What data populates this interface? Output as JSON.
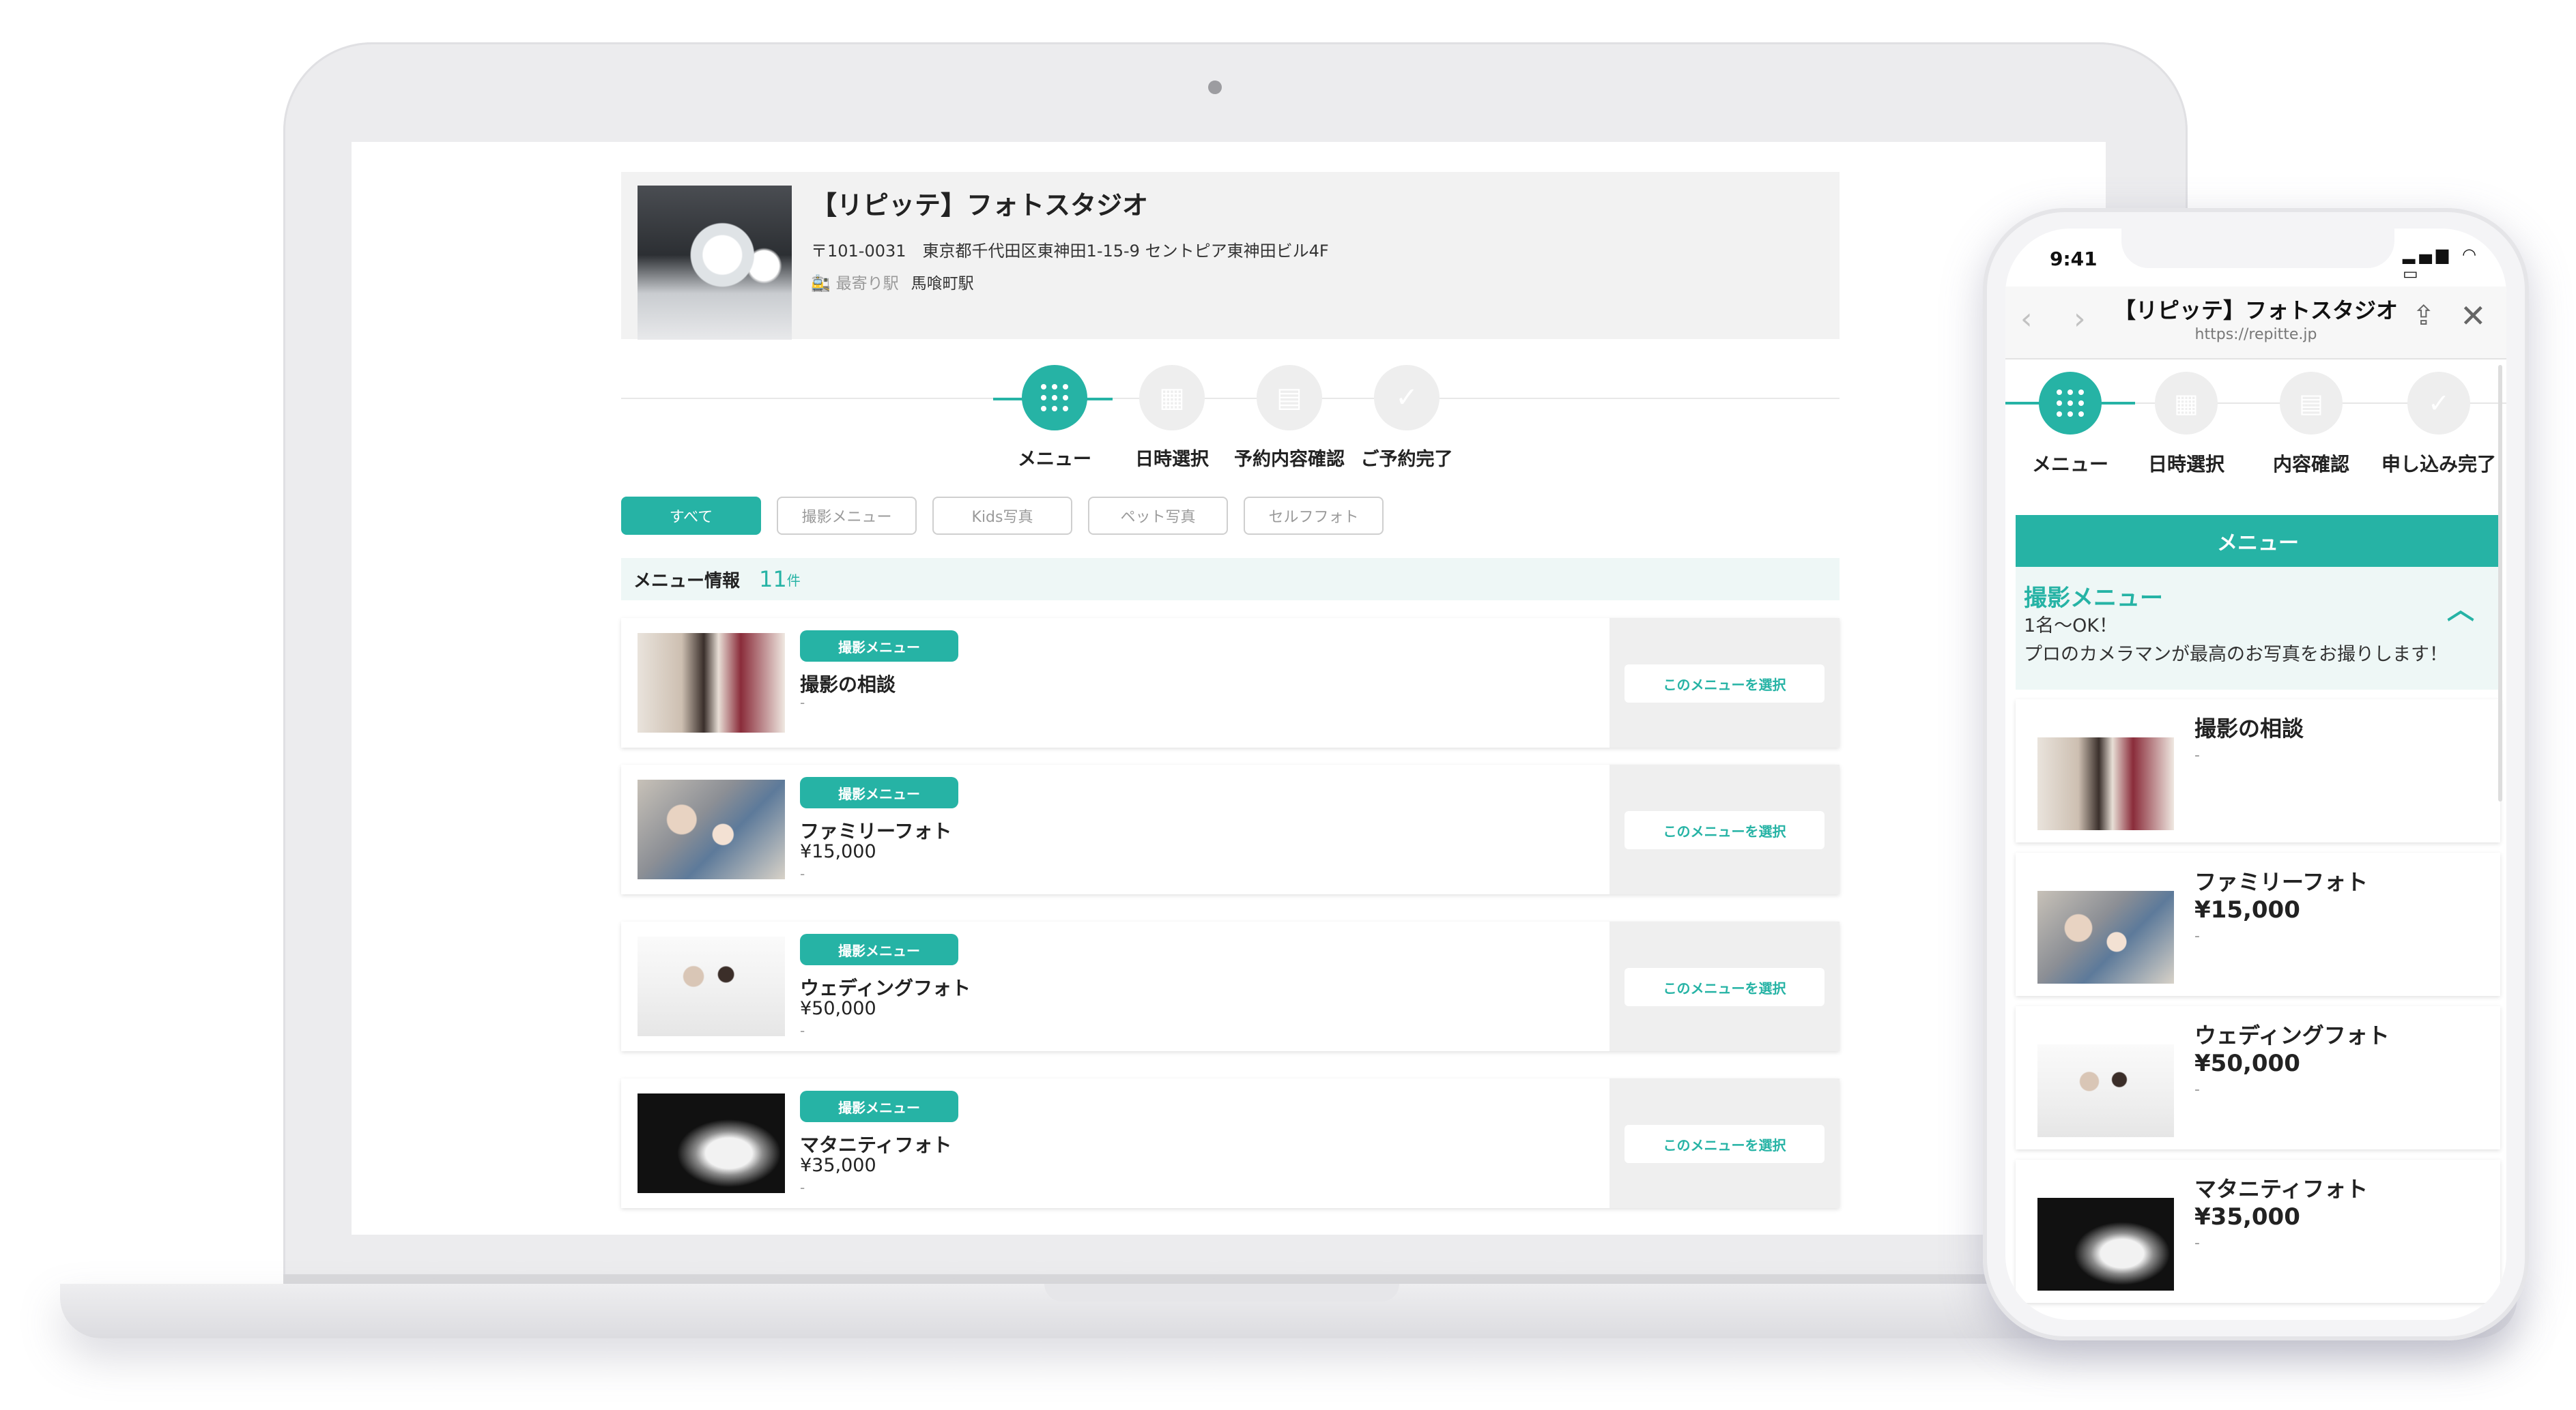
{
  "studio": {
    "name": "【リピッテ】フォトスタジオ",
    "address": "〒101-0031　東京都千代田区東神田1-15-9 セントピア東神田ビル4F",
    "station_label": "最寄り駅",
    "station": "馬喰町駅"
  },
  "steps": [
    {
      "label": "メニュー",
      "active": true
    },
    {
      "label": "日時選択",
      "active": false
    },
    {
      "label": "予約内容確認",
      "active": false
    },
    {
      "label": "ご予約完了",
      "active": false
    }
  ],
  "tabs": [
    "すべて",
    "撮影メニュー",
    "Kids写真",
    "ペット写真",
    "セルフフォト"
  ],
  "menu_info": {
    "label": "メニュー情報",
    "count": "11",
    "unit": "件"
  },
  "menus": [
    {
      "badge": "撮影メニュー",
      "name": "撮影の相談",
      "price": "",
      "note": "-",
      "button": "このメニューを選択"
    },
    {
      "badge": "撮影メニュー",
      "name": "ファミリーフォト",
      "price": "¥15,000",
      "note": "-",
      "button": "このメニューを選択"
    },
    {
      "badge": "撮影メニュー",
      "name": "ウェディングフォト",
      "price": "¥50,000",
      "note": "-",
      "button": "このメニューを選択"
    },
    {
      "badge": "撮影メニュー",
      "name": "マタニティフォト",
      "price": "¥35,000",
      "note": "-",
      "button": "このメニューを選択"
    }
  ],
  "phone": {
    "time": "9:41",
    "status": "▂▄▆ ◠ ▭",
    "nav": {
      "back": "‹",
      "forward": "›",
      "title": "【リピッテ】フォトスタジオ",
      "url": "https://repitte.jp",
      "share": "⇪",
      "close": "✕"
    },
    "steps": [
      {
        "label": "メニュー",
        "active": true
      },
      {
        "label": "日時選択",
        "active": false
      },
      {
        "label": "内容確認",
        "active": false
      },
      {
        "label": "申し込み完了",
        "active": false
      }
    ],
    "menu_header": "メニュー",
    "category": {
      "title": "撮影メニュー",
      "text": "1名〜OK！\nプロのカメラマンが最高のお写真をお撮りします！",
      "chevron": "︿"
    },
    "menus": [
      {
        "name": "撮影の相談",
        "price": "",
        "note": "-"
      },
      {
        "name": "ファミリーフォト",
        "price": "¥15,000",
        "note": "-"
      },
      {
        "name": "ウェディングフォト",
        "price": "¥50,000",
        "note": "-"
      },
      {
        "name": "マタニティフォト",
        "price": "¥35,000",
        "note": "-"
      }
    ]
  },
  "colors": {
    "accent": "#26b3a5",
    "accent_light": "#eef7f6"
  }
}
